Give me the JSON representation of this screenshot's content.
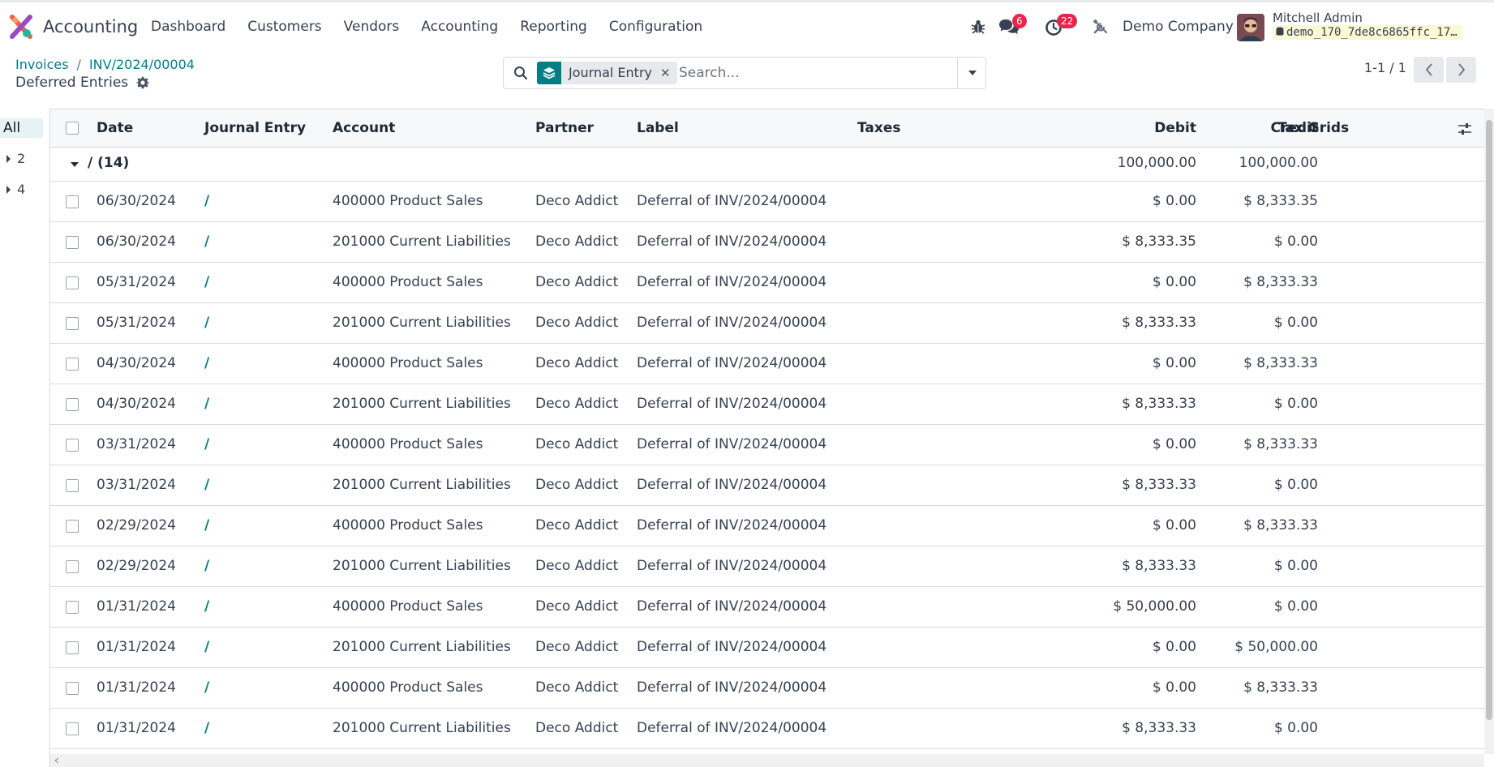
{
  "navbar": {
    "app_name": "Accounting",
    "menu": [
      "Dashboard",
      "Customers",
      "Vendors",
      "Accounting",
      "Reporting",
      "Configuration"
    ],
    "chat_badge": "6",
    "activity_badge": "22",
    "company": "Demo Company",
    "user_name": "Mitchell Admin",
    "db_name": "demo_170_7de8c6865ffc_17…"
  },
  "breadcrumb": {
    "parent": "Invoices",
    "record": "INV/2024/00004",
    "current": "Deferred Entries"
  },
  "search": {
    "facet_label": "Journal Entry",
    "placeholder": "Search..."
  },
  "pager": {
    "value": "1-1 / 1"
  },
  "sidepanel": {
    "all_label": "All",
    "items": [
      "2",
      "4"
    ]
  },
  "table": {
    "columns": {
      "date": "Date",
      "journal_entry": "Journal Entry",
      "account": "Account",
      "partner": "Partner",
      "label": "Label",
      "taxes": "Taxes",
      "debit": "Debit",
      "credit": "Credit",
      "tax_grids": "Tax Grids"
    },
    "group": {
      "label": "/ (14)",
      "debit": "100,000.00",
      "credit": "100,000.00"
    },
    "rows": [
      {
        "date": "06/30/2024",
        "entry": "/",
        "account": "400000 Product Sales",
        "partner": "Deco Addict",
        "label": "Deferral of INV/2024/00004",
        "debit": "$ 0.00",
        "credit": "$ 8,333.35"
      },
      {
        "date": "06/30/2024",
        "entry": "/",
        "account": "201000 Current Liabilities",
        "partner": "Deco Addict",
        "label": "Deferral of INV/2024/00004",
        "debit": "$ 8,333.35",
        "credit": "$ 0.00"
      },
      {
        "date": "05/31/2024",
        "entry": "/",
        "account": "400000 Product Sales",
        "partner": "Deco Addict",
        "label": "Deferral of INV/2024/00004",
        "debit": "$ 0.00",
        "credit": "$ 8,333.33"
      },
      {
        "date": "05/31/2024",
        "entry": "/",
        "account": "201000 Current Liabilities",
        "partner": "Deco Addict",
        "label": "Deferral of INV/2024/00004",
        "debit": "$ 8,333.33",
        "credit": "$ 0.00"
      },
      {
        "date": "04/30/2024",
        "entry": "/",
        "account": "400000 Product Sales",
        "partner": "Deco Addict",
        "label": "Deferral of INV/2024/00004",
        "debit": "$ 0.00",
        "credit": "$ 8,333.33"
      },
      {
        "date": "04/30/2024",
        "entry": "/",
        "account": "201000 Current Liabilities",
        "partner": "Deco Addict",
        "label": "Deferral of INV/2024/00004",
        "debit": "$ 8,333.33",
        "credit": "$ 0.00"
      },
      {
        "date": "03/31/2024",
        "entry": "/",
        "account": "400000 Product Sales",
        "partner": "Deco Addict",
        "label": "Deferral of INV/2024/00004",
        "debit": "$ 0.00",
        "credit": "$ 8,333.33"
      },
      {
        "date": "03/31/2024",
        "entry": "/",
        "account": "201000 Current Liabilities",
        "partner": "Deco Addict",
        "label": "Deferral of INV/2024/00004",
        "debit": "$ 8,333.33",
        "credit": "$ 0.00"
      },
      {
        "date": "02/29/2024",
        "entry": "/",
        "account": "400000 Product Sales",
        "partner": "Deco Addict",
        "label": "Deferral of INV/2024/00004",
        "debit": "$ 0.00",
        "credit": "$ 8,333.33"
      },
      {
        "date": "02/29/2024",
        "entry": "/",
        "account": "201000 Current Liabilities",
        "partner": "Deco Addict",
        "label": "Deferral of INV/2024/00004",
        "debit": "$ 8,333.33",
        "credit": "$ 0.00"
      },
      {
        "date": "01/31/2024",
        "entry": "/",
        "account": "400000 Product Sales",
        "partner": "Deco Addict",
        "label": "Deferral of INV/2024/00004",
        "debit": "$ 50,000.00",
        "credit": "$ 0.00"
      },
      {
        "date": "01/31/2024",
        "entry": "/",
        "account": "201000 Current Liabilities",
        "partner": "Deco Addict",
        "label": "Deferral of INV/2024/00004",
        "debit": "$ 0.00",
        "credit": "$ 50,000.00"
      },
      {
        "date": "01/31/2024",
        "entry": "/",
        "account": "400000 Product Sales",
        "partner": "Deco Addict",
        "label": "Deferral of INV/2024/00004",
        "debit": "$ 0.00",
        "credit": "$ 8,333.33"
      },
      {
        "date": "01/31/2024",
        "entry": "/",
        "account": "201000 Current Liabilities",
        "partner": "Deco Addict",
        "label": "Deferral of INV/2024/00004",
        "debit": "$ 8,333.33",
        "credit": "$ 0.00"
      }
    ]
  },
  "colors": {
    "brand": "#017e84",
    "badge": "#e8244b"
  },
  "icons": [
    "app-logo-icon",
    "bug-icon",
    "chat-icon",
    "clock-icon",
    "tools-icon",
    "gear-icon",
    "search-icon",
    "layers-icon",
    "close-icon",
    "caret-down-icon",
    "chevron-left-icon",
    "chevron-right-icon",
    "column-settings-icon"
  ]
}
